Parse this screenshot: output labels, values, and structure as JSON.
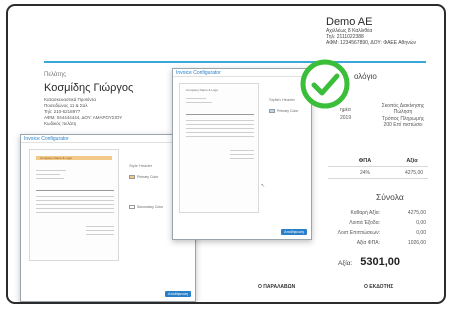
{
  "company": {
    "name": "Demo AE",
    "lines": [
      "Αχιλλέως 8 Καλλιθέα",
      "Τηλ: 2111022388",
      "ΑΦΜ: 1234567890, ΔΟΥ: ΦΑΕΕ Αθηνών"
    ]
  },
  "client": {
    "label": "Πελάτης",
    "name": "Κοσμίδης Γιώργος",
    "lines": [
      "Κατασκευαστικά Προϊόντα",
      "Ποσειδώνος 11 & Σαλ",
      "Τηλ: 210-6218977",
      "ΑΦΜ: 044444444, ΔΟΥ: ΑΜΑΡΟΥΣΙΟΥ",
      "Κωδικός πελάτη"
    ]
  },
  "document": {
    "title_partial": "ολόγιο",
    "info": [
      {
        "label": "Σκοπός Διακίνησης",
        "value": "Πώληση"
      },
      {
        "label": "Τρόπος Πληρωμής",
        "value": "200 Επί πιστώσει"
      }
    ],
    "info_left": [
      "ημέα",
      "2019"
    ]
  },
  "table": {
    "headers": [
      "ΦΠΑ",
      "Αξία"
    ],
    "row": [
      "24%",
      "4275,00"
    ]
  },
  "totals": {
    "title": "Σύνολα",
    "rows": [
      {
        "label": "Καθαρή Αξία:",
        "value": "4275,00"
      },
      {
        "label": "Λοιπά Έξοδα:",
        "value": "0,00"
      },
      {
        "label": "Λοιπ Επιπτώσεων:",
        "value": "0,00"
      },
      {
        "label": "Αξία ΦΠΑ:",
        "value": "1026,00"
      }
    ],
    "grand_label": "Αξία:",
    "grand_value": "5301,00"
  },
  "footer": {
    "left": "Ο ΠΑΡΑΛΑΒΩΝ",
    "right": "Ο ΕΚΔΟΤΗΣ"
  },
  "config_window_back": {
    "title": "Invoice Configurator",
    "header_text": "Company Name & Logo",
    "side_label": "Style Header",
    "options": [
      "Primary Color"
    ],
    "apply_label": "Αποθήκευση"
  },
  "config_window_front": {
    "title": "Invoice Configurator",
    "header_text": "Company Name & Logo",
    "side_label": "Stylish Header",
    "options": [
      "Primary Color",
      "Secondary Color"
    ],
    "apply_label": "Αποθήκευση"
  },
  "colors": {
    "accent_blue": "#3aa8d8",
    "check_green": "#3bbf3b",
    "header_orange": "#f3c98a"
  },
  "icons": {
    "check": "check-circle-icon"
  }
}
